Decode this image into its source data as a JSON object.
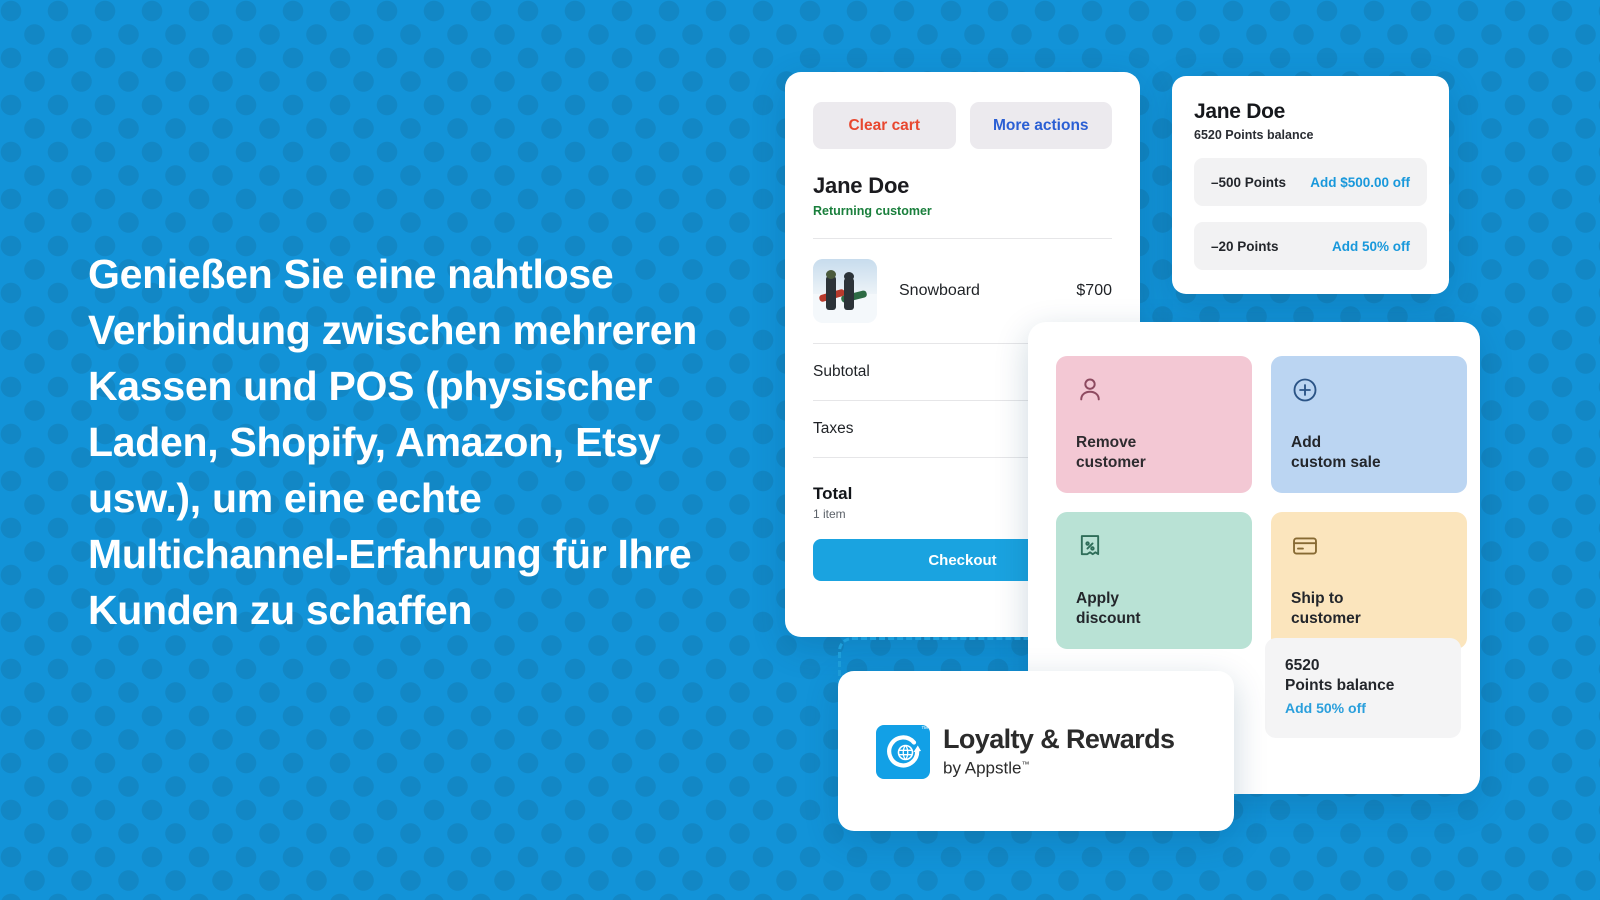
{
  "theme": {
    "background": "#1293d8",
    "dot_color": "#1386c4",
    "accent_blue": "#1aa3e0",
    "link_blue": "#1898db",
    "danger_red": "#e8472f",
    "success_green": "#1a7f3c"
  },
  "headline": {
    "text": "Genießen Sie eine nahtlose Verbindung zwischen mehreren Kassen und POS (physischer Laden, Shopify, Amazon, Etsy usw.), um eine echte Multichannel-Erfahrung für Ihre Kunden zu schaffen"
  },
  "cart": {
    "clear_cart_label": "Clear cart",
    "more_actions_label": "More actions",
    "customer_name": "Jane Doe",
    "customer_status": "Returning customer",
    "line_items": [
      {
        "name": "Snowboard",
        "price": "$700",
        "thumb_icon": "snowboarders-photo"
      }
    ],
    "subtotal_label": "Subtotal",
    "subtotal_value": "",
    "taxes_label": "Taxes",
    "taxes_value": "",
    "total_label": "Total",
    "total_item_count": "1 item",
    "total_value": "",
    "checkout_label": "Checkout"
  },
  "points_card": {
    "name": "Jane Doe",
    "balance_text": "6520 Points balance",
    "rewards": [
      {
        "points": "–500 Points",
        "action": "Add $500.00 off"
      },
      {
        "points": "–20 Points",
        "action": "Add 50% off"
      }
    ]
  },
  "action_panel": {
    "tiles": [
      {
        "id": "remove-customer",
        "label": "Remove\ncustomer",
        "icon": "person-icon",
        "bg": "#f3c8d4",
        "stroke": "#8d4a60"
      },
      {
        "id": "add-custom-sale",
        "label": "Add\ncustom sale",
        "icon": "plus-circle-icon",
        "bg": "#bbd5f2",
        "stroke": "#2b5486"
      },
      {
        "id": "apply-discount",
        "label": "Apply\ndiscount",
        "icon": "receipt-percent-icon",
        "bg": "#b9e2d5",
        "stroke": "#2f6d59"
      },
      {
        "id": "ship-to-customer",
        "label": "Ship to\ncustomer",
        "icon": "credit-card-icon",
        "bg": "#fbe5bd",
        "stroke": "#876a33"
      }
    ]
  },
  "points_balance_tile": {
    "number": "6520",
    "label": "Points balance",
    "action": "Add  50% off"
  },
  "logo_card": {
    "mark_icon": "appstle-globe-arrow-icon",
    "title": "Loyalty & Rewards",
    "subtitle": "by Appstle",
    "trademark": "™"
  }
}
